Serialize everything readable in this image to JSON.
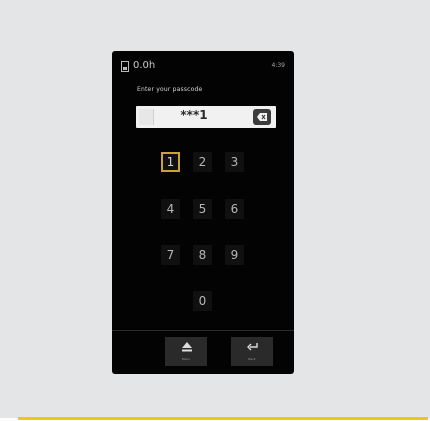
{
  "status": {
    "battery": "0.0h",
    "time": "4:39"
  },
  "prompt": "Enter your passcode",
  "passcode": {
    "display": "***1"
  },
  "keypad": {
    "keys": [
      "1",
      "2",
      "3",
      "4",
      "5",
      "6",
      "7",
      "8",
      "9",
      "0"
    ],
    "selected_key": "1"
  },
  "softkeys": {
    "left_label": "Menu",
    "right_label": "Back"
  },
  "colors": {
    "accent": "#f3c318",
    "selection": "#c9a334",
    "screen": "#030303"
  },
  "icons": {
    "battery": "battery-icon",
    "backspace": "backspace-icon",
    "eject": "eject-icon",
    "back": "return-arrow-icon"
  }
}
